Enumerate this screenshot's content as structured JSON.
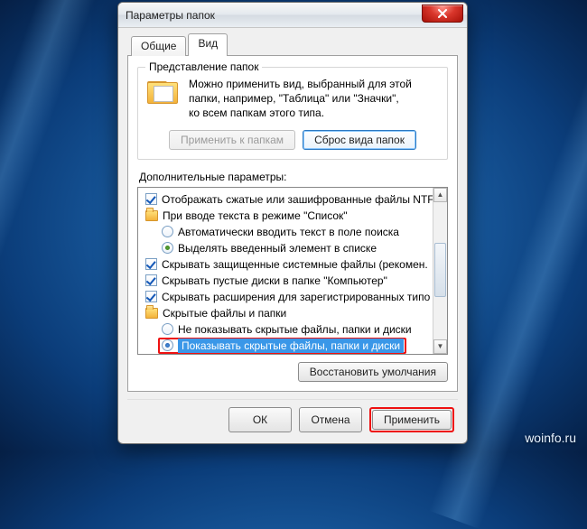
{
  "watermark": "woinfo.ru",
  "window": {
    "title": "Параметры папок",
    "tabs": {
      "general": "Общие",
      "view": "Вид"
    },
    "groupbox": {
      "legend": "Представление папок",
      "desc_l1": "Можно применить вид, выбранный для этой",
      "desc_l2": "папки, например, \"Таблица\" или \"Значки\",",
      "desc_l3": "ко всем папкам этого типа.",
      "apply_btn": "Применить к папкам",
      "reset_btn": "Сброс вида папок"
    },
    "advanced_label": "Дополнительные параметры:",
    "tree": {
      "i0": "Отображать сжатые или зашифрованные файлы NTF",
      "i1": "При вводе текста в режиме \"Список\"",
      "i1a": "Автоматически вводить текст в поле поиска",
      "i1b": "Выделять введенный элемент в списке",
      "i2": "Скрывать защищенные системные файлы (рекомен.",
      "i3": "Скрывать пустые диски в папке \"Компьютер\"",
      "i4": "Скрывать расширения для зарегистрированных типо",
      "i5": "Скрытые файлы и папки",
      "i5a": "Не показывать скрытые файлы, папки и диски",
      "i5b": "Показывать скрытые файлы, папки и диски"
    },
    "restore_btn": "Восстановить умолчания",
    "ok_btn": "ОК",
    "cancel_btn": "Отмена",
    "apply_btn": "Применить"
  }
}
